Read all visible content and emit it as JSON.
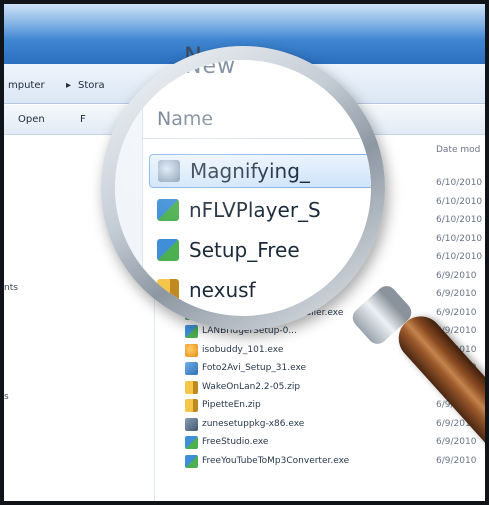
{
  "window": {
    "title": "New"
  },
  "address_bar": {
    "crumbs": [
      "mputer",
      "Stora"
    ],
    "separator": "▸"
  },
  "toolbar": {
    "open_label": "Open",
    "truncated_label": "F"
  },
  "nav_pane": {
    "items": [
      {
        "label": "nts"
      },
      {
        "label": "s"
      }
    ]
  },
  "list": {
    "date_header": "Date mod",
    "rows": [
      {
        "name": "",
        "date": "6/10/2010",
        "icon": "globe-icon"
      },
      {
        "name": "",
        "date": "6/10/2010",
        "icon": "setup-icon"
      },
      {
        "name": "",
        "date": "6/10/2010",
        "icon": "setup-icon"
      },
      {
        "name": "",
        "date": "6/10/2010",
        "icon": "setup-icon"
      },
      {
        "name": "",
        "date": "6/10/2010",
        "icon": "setup-icon"
      },
      {
        "name": "",
        "date": "6/9/2010",
        "icon": "zip-icon"
      },
      {
        "name": "",
        "date": "6/9/2010",
        "icon": "setup-icon"
      },
      {
        "name": "workrave-win32-...-installer.exe",
        "date": "6/9/2010",
        "icon": "setup-icon"
      },
      {
        "name": "LANBridgerSetup-0...",
        "date": "6/9/2010",
        "icon": "setup-icon"
      },
      {
        "name": "isobuddy_101.exe",
        "date": "6/9/2010",
        "icon": "orange-disc-icon"
      },
      {
        "name": "Foto2Avi_Setup_31.exe",
        "date": "6/9/2010",
        "icon": "blue-app-icon"
      },
      {
        "name": "WakeOnLan2.2-05.zip",
        "date": "6/9/2010",
        "icon": "zip-icon"
      },
      {
        "name": "PipetteEn.zip",
        "date": "6/9/2010",
        "icon": "zip-icon"
      },
      {
        "name": "zunesetuppkg-x86.exe",
        "date": "6/9/2010",
        "icon": "gray-app-icon"
      },
      {
        "name": "FreeStudio.exe",
        "date": "6/9/2010",
        "icon": "setup-icon"
      },
      {
        "name": "FreeYouTubeToMp3Converter.exe",
        "date": "6/9/2010",
        "icon": "setup-icon"
      }
    ]
  },
  "magnified": {
    "title": "New",
    "column_header": "Name",
    "rows": [
      {
        "name": "Magnifying_",
        "icon": "globe-icon",
        "selected": true
      },
      {
        "name": "nFLVPlayer_S",
        "icon": "setup-icon",
        "selected": false
      },
      {
        "name": "Setup_Free",
        "icon": "setup-icon",
        "selected": false
      },
      {
        "name": "nexusf",
        "icon": "zip-icon",
        "selected": false
      }
    ]
  },
  "colors": {
    "selection_border": "#84b4e6",
    "title_bar_blue": "#3f86d2",
    "handle_wood": "#9c5a2c"
  }
}
